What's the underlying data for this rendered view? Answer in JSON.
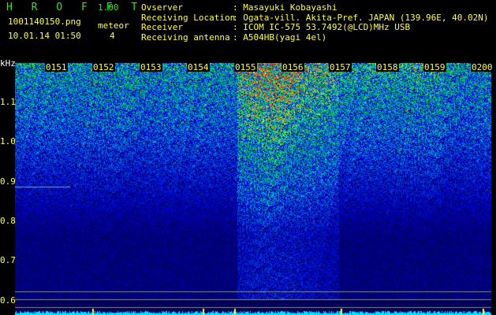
{
  "header": {
    "app_name": "H R O F F T",
    "version": "1.00",
    "filename": "1001140150.png",
    "datetime": "10.01.14 01:50",
    "meteor_label": "meteor",
    "meteor_count": "4"
  },
  "info": [
    {
      "label": "Ovserver",
      "value": ": Masayuki Kobayashi"
    },
    {
      "label": "Receiving Location",
      "value": ": Ogata-vill. Akita-Pref. JAPAN (139.96E, 40.02N)"
    },
    {
      "label": "Receiver",
      "value": ": ICOM IC-575 53.7492(@LCD)MHz USB"
    },
    {
      "label": "Receiving antenna",
      "value": ": A504HB(yagi 4el)"
    }
  ],
  "spectrogram": {
    "freq_unit": "kHz",
    "freq_labels": [
      "1.1",
      "1.0",
      "0.9",
      "0.8",
      "0.7",
      "0.6"
    ],
    "time_labels": [
      "0151",
      "0152",
      "0153",
      "0154",
      "0155",
      "0156",
      "0157",
      "0158",
      "0159",
      "0200"
    ],
    "colors": {
      "text": "#ffff3c",
      "logo": "#2fe02f",
      "baseline": "#00e0ff"
    }
  }
}
